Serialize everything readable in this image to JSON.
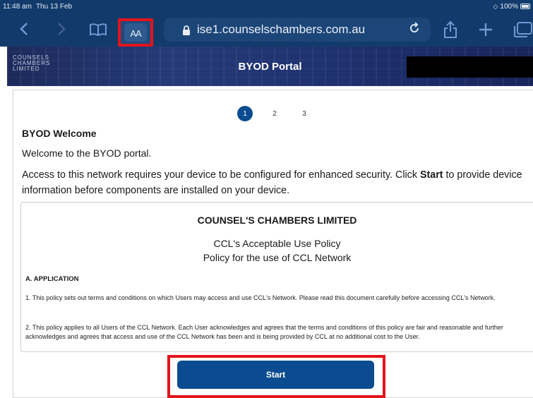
{
  "status_bar": {
    "time": "11:48 am",
    "date": "Thu 13 Feb",
    "battery": "100%"
  },
  "browser": {
    "aa_label": "AA",
    "url": "ise1.counselschambers.com.au"
  },
  "header": {
    "logo_lines": [
      "COUNSELS",
      "CHAMBERS",
      "LIMITED"
    ],
    "title": "BYOD Portal"
  },
  "stepper": {
    "steps": [
      "1",
      "2",
      "3"
    ],
    "active": 1
  },
  "content": {
    "heading": "BYOD Welcome",
    "welcome": "Welcome to the BYOD portal.",
    "access_before": "Access to this network requires your device to be configured for enhanced security. Click ",
    "access_bold": "Start",
    "access_after": " to provide device information before components are installed on your device."
  },
  "policy": {
    "org": "COUNSEL'S CHAMBERS LIMITED",
    "title_line1": "CCL's Acceptable Use Policy",
    "title_line2": "Policy for the use of CCL Network",
    "section": "A. APPLICATION",
    "para1": "1. This policy sets out terms and conditions on which Users may access and use CCL's Network. Please read this document carefully before accessing CCL's Network.",
    "para2": "2. This policy applies to all Users of the CCL Network. Each User acknowledges and agrees that the terms and conditions of this policy are fair and reasonable and further acknowledges and agrees that access and use of the CCL Network has been and is being provided by CCL at no additional cost to the User."
  },
  "actions": {
    "start_label": "Start"
  },
  "colors": {
    "toolbar": "#123b6b",
    "primary": "#0a4c8f",
    "highlight": "#e3141b"
  }
}
